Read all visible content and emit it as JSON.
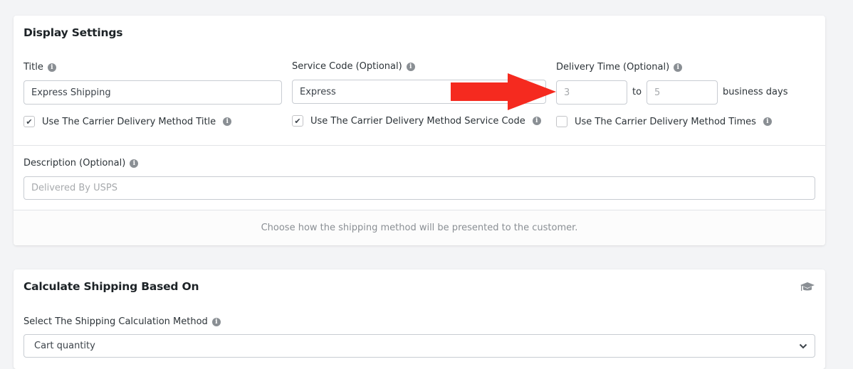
{
  "display_settings": {
    "title": "Display Settings",
    "title_field": {
      "label": "Title",
      "value": "Express Shipping",
      "checkbox_label": "Use The Carrier Delivery Method Title",
      "checkbox_checked": true
    },
    "service_code_field": {
      "label": "Service Code (Optional)",
      "value": "Express",
      "checkbox_label": "Use The Carrier Delivery Method Service Code",
      "checkbox_checked": true
    },
    "delivery_time_field": {
      "label": "Delivery Time (Optional)",
      "min_placeholder": "3",
      "separator": "to",
      "max_placeholder": "5",
      "unit": "business days",
      "checkbox_label": "Use The Carrier Delivery Method Times",
      "checkbox_checked": false
    },
    "description_field": {
      "label": "Description (Optional)",
      "placeholder": "Delivered By USPS"
    },
    "footer_text": "Choose how the shipping method will be presented to the customer."
  },
  "calculate_shipping": {
    "title": "Calculate Shipping Based On",
    "method_field": {
      "label": "Select The Shipping Calculation Method",
      "selected": "Cart quantity"
    }
  },
  "icons": {
    "info": "info-icon",
    "check": "checkmark-icon",
    "graduation": "graduation-cap-icon",
    "annotation_arrow": "red-arrow-icon",
    "chevron": "chevron-down-icon"
  },
  "colors": {
    "annotation_arrow": "#f52a1f",
    "background": "#f3f4f6",
    "card": "#ffffff"
  }
}
